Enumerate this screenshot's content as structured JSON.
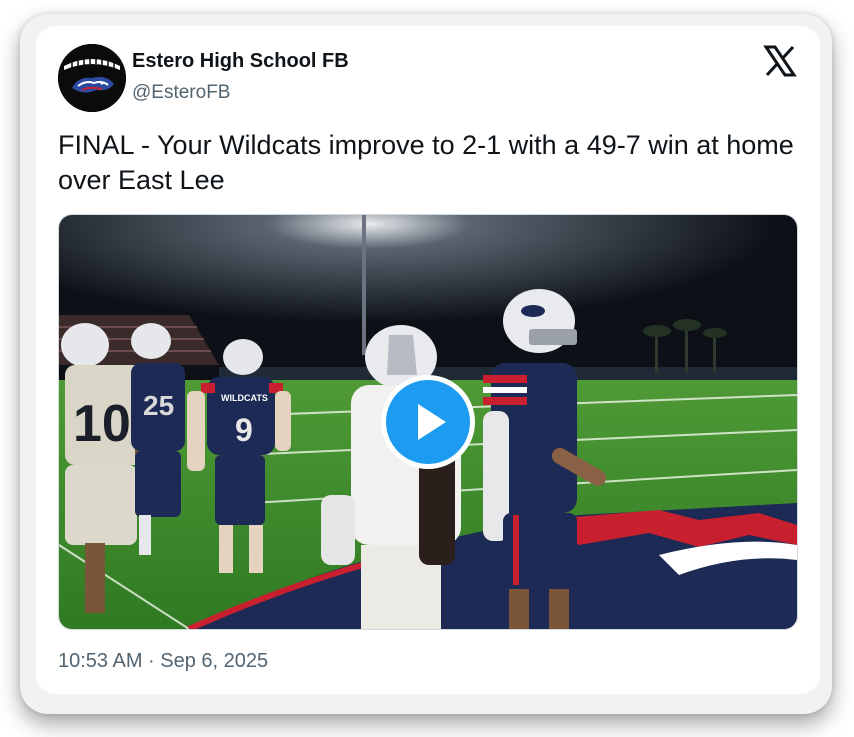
{
  "account": {
    "name": "Estero High School FB",
    "handle": "@EsteroFB",
    "avatar_icon": "wildcat-logo-icon"
  },
  "platform_icon": "x-logo-icon",
  "tweet": {
    "text": "FINAL - Your Wildcats improve to 2-1 with a 49-7 win at home over East Lee",
    "timestamp": "10:53 AM · Sep 6, 2025"
  },
  "media": {
    "type": "video",
    "play_icon": "play-icon",
    "jersey_numbers": [
      "10",
      "25",
      "9"
    ],
    "jersey_text": "WILDCATS"
  },
  "colors": {
    "accent": "#1d9bf0",
    "text": "#0f1419",
    "secondary_text": "#536471",
    "field_green": "#3f8f2e",
    "navy": "#1c2a55",
    "red": "#c8202f"
  }
}
